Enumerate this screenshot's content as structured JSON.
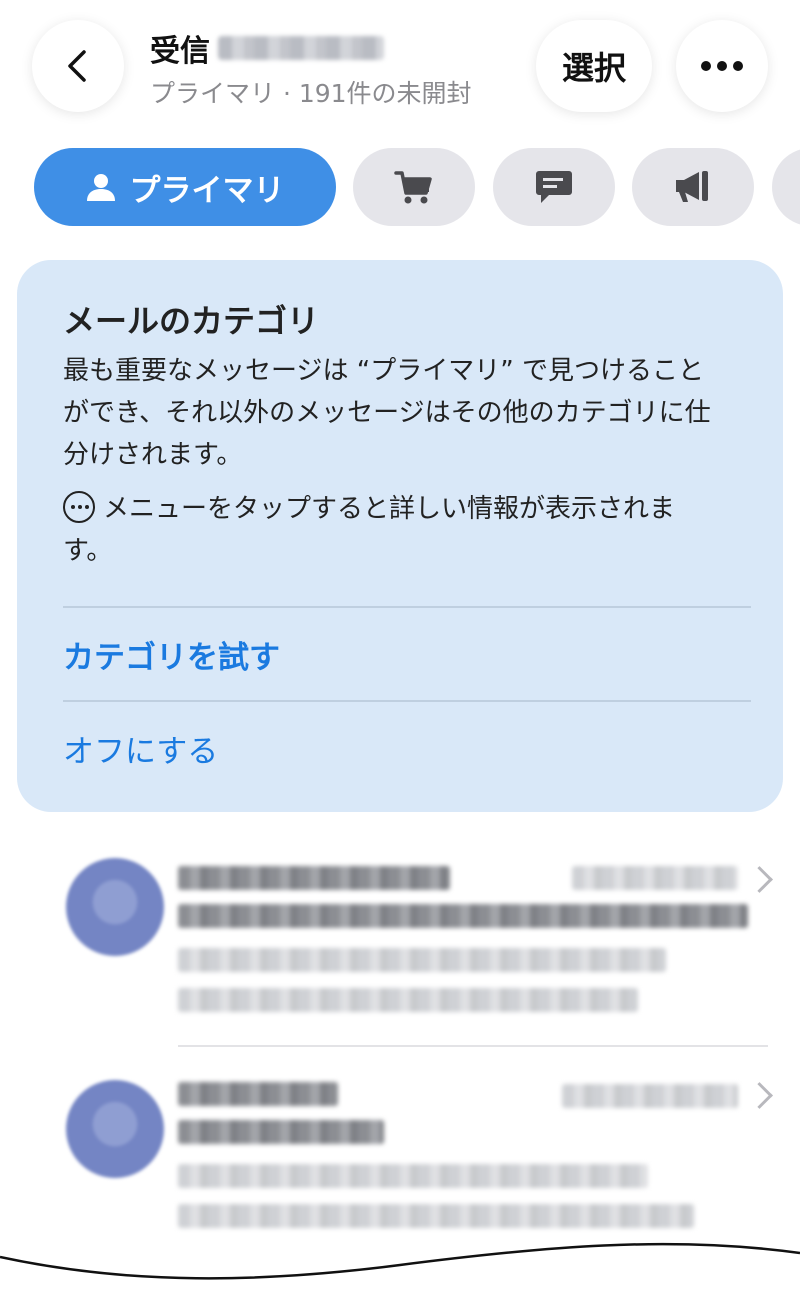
{
  "header": {
    "title": "受信",
    "subtitle": "プライマリ · 191件の未開封",
    "select_label": "選択"
  },
  "tabs": [
    {
      "label": "プライマリ",
      "icon": "person-icon",
      "active": true
    },
    {
      "icon": "cart-icon"
    },
    {
      "icon": "chat-bubble-icon"
    },
    {
      "icon": "megaphone-icon"
    }
  ],
  "card": {
    "title": "メールのカテゴリ",
    "body": "最も重要なメッセージは “プライマリ” で見つけることができ、それ以外のメッセージはその他のカテゴリに仕分けされます。",
    "hint": "メニューをタップすると詳しい情報が表示されます。",
    "try_label": "カテゴリを試す",
    "off_label": "オフにする"
  },
  "colors": {
    "accent": "#3f8fe6",
    "link": "#1a7ae0",
    "card_bg": "#d9e8f8",
    "tab_bg": "#e5e5ea"
  }
}
